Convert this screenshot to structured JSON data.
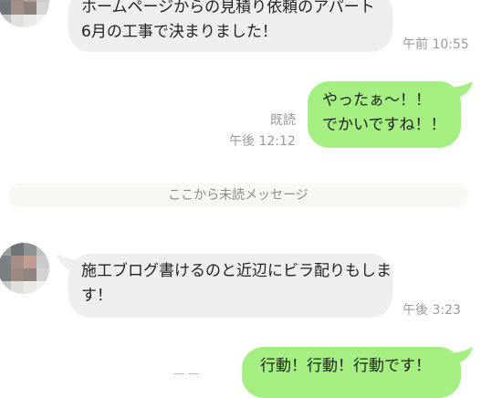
{
  "messages": [
    {
      "side": "incoming",
      "lines": [
        "ホームページからの見積り依頼のアパート",
        "6月の工事で決まりました！"
      ],
      "time": "午前 10:55"
    },
    {
      "side": "outgoing",
      "lines": [
        "やったぁ〜！！",
        "でかいですね！！"
      ],
      "read": "既読",
      "time": "午後 12:12"
    },
    {
      "side": "incoming",
      "lines": [
        "施工ブログ書けるのと近辺にビラ配りもしま",
        "す！"
      ],
      "time": "午後 3:23"
    },
    {
      "side": "outgoing",
      "lines": [
        "行動！行動！行動です！"
      ]
    }
  ],
  "unread_divider": "ここから未読メッセージ",
  "colors": {
    "incoming_bubble": "#eeeeee",
    "outgoing_bubble": "#a5ef82",
    "meta_text": "#9a9a9a",
    "divider_bg": "#f5f9f2"
  },
  "icons": {
    "avatar": "pixelated-user-avatar"
  }
}
